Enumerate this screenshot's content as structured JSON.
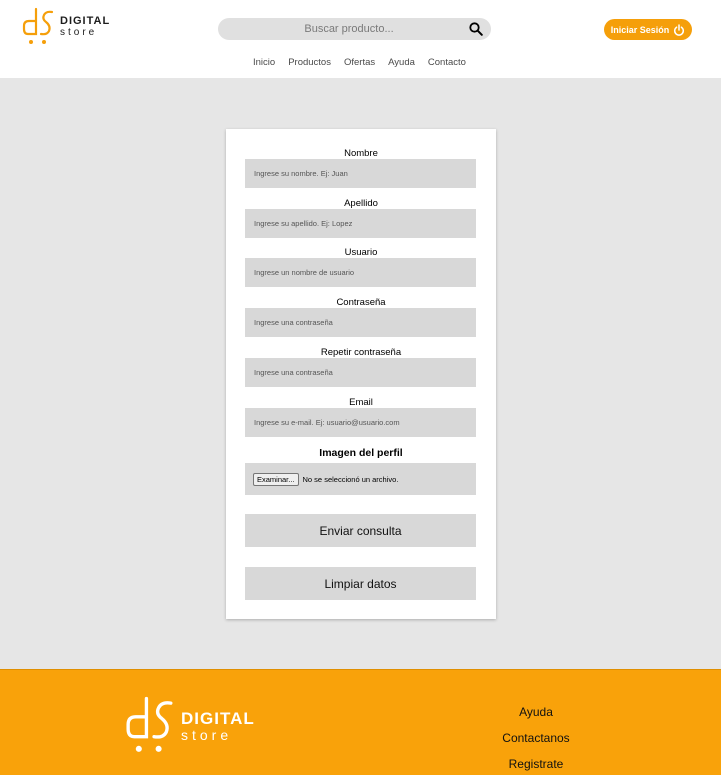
{
  "brand": {
    "word1": "DIGITAL",
    "word2": "store",
    "accent": "#f59f0a"
  },
  "search": {
    "placeholder": "Buscar producto...",
    "icon": "search-icon"
  },
  "header": {
    "login_label": "Iniciar Sesión",
    "login_icon": "power-icon"
  },
  "nav": {
    "items": [
      "Inicio",
      "Productos",
      "Ofertas",
      "Ayuda",
      "Contacto"
    ]
  },
  "form": {
    "fields": [
      {
        "label": "Nombre",
        "placeholder": "Ingrese su nombre. Ej: Juan"
      },
      {
        "label": "Apellido",
        "placeholder": "Ingrese su apellido. Ej: Lopez"
      },
      {
        "label": "Usuario",
        "placeholder": "Ingrese un nombre de usuario"
      },
      {
        "label": "Contraseña",
        "placeholder": "Ingrese una contraseña"
      },
      {
        "label": "Repetir contraseña",
        "placeholder": "Ingrese una contraseña"
      },
      {
        "label": "Email",
        "placeholder": "Ingrese su e-mail. Ej: usuario@usuario.com"
      }
    ],
    "image_label": "Imagen del perfil",
    "file_button": "Examinar...",
    "file_status": "No se seleccionó un archivo.",
    "submit_label": "Enviar consulta",
    "reset_label": "Limpiar datos"
  },
  "footer": {
    "links": [
      "Ayuda",
      "Contactanos",
      "Registrate"
    ],
    "background": "#f9a20a"
  }
}
